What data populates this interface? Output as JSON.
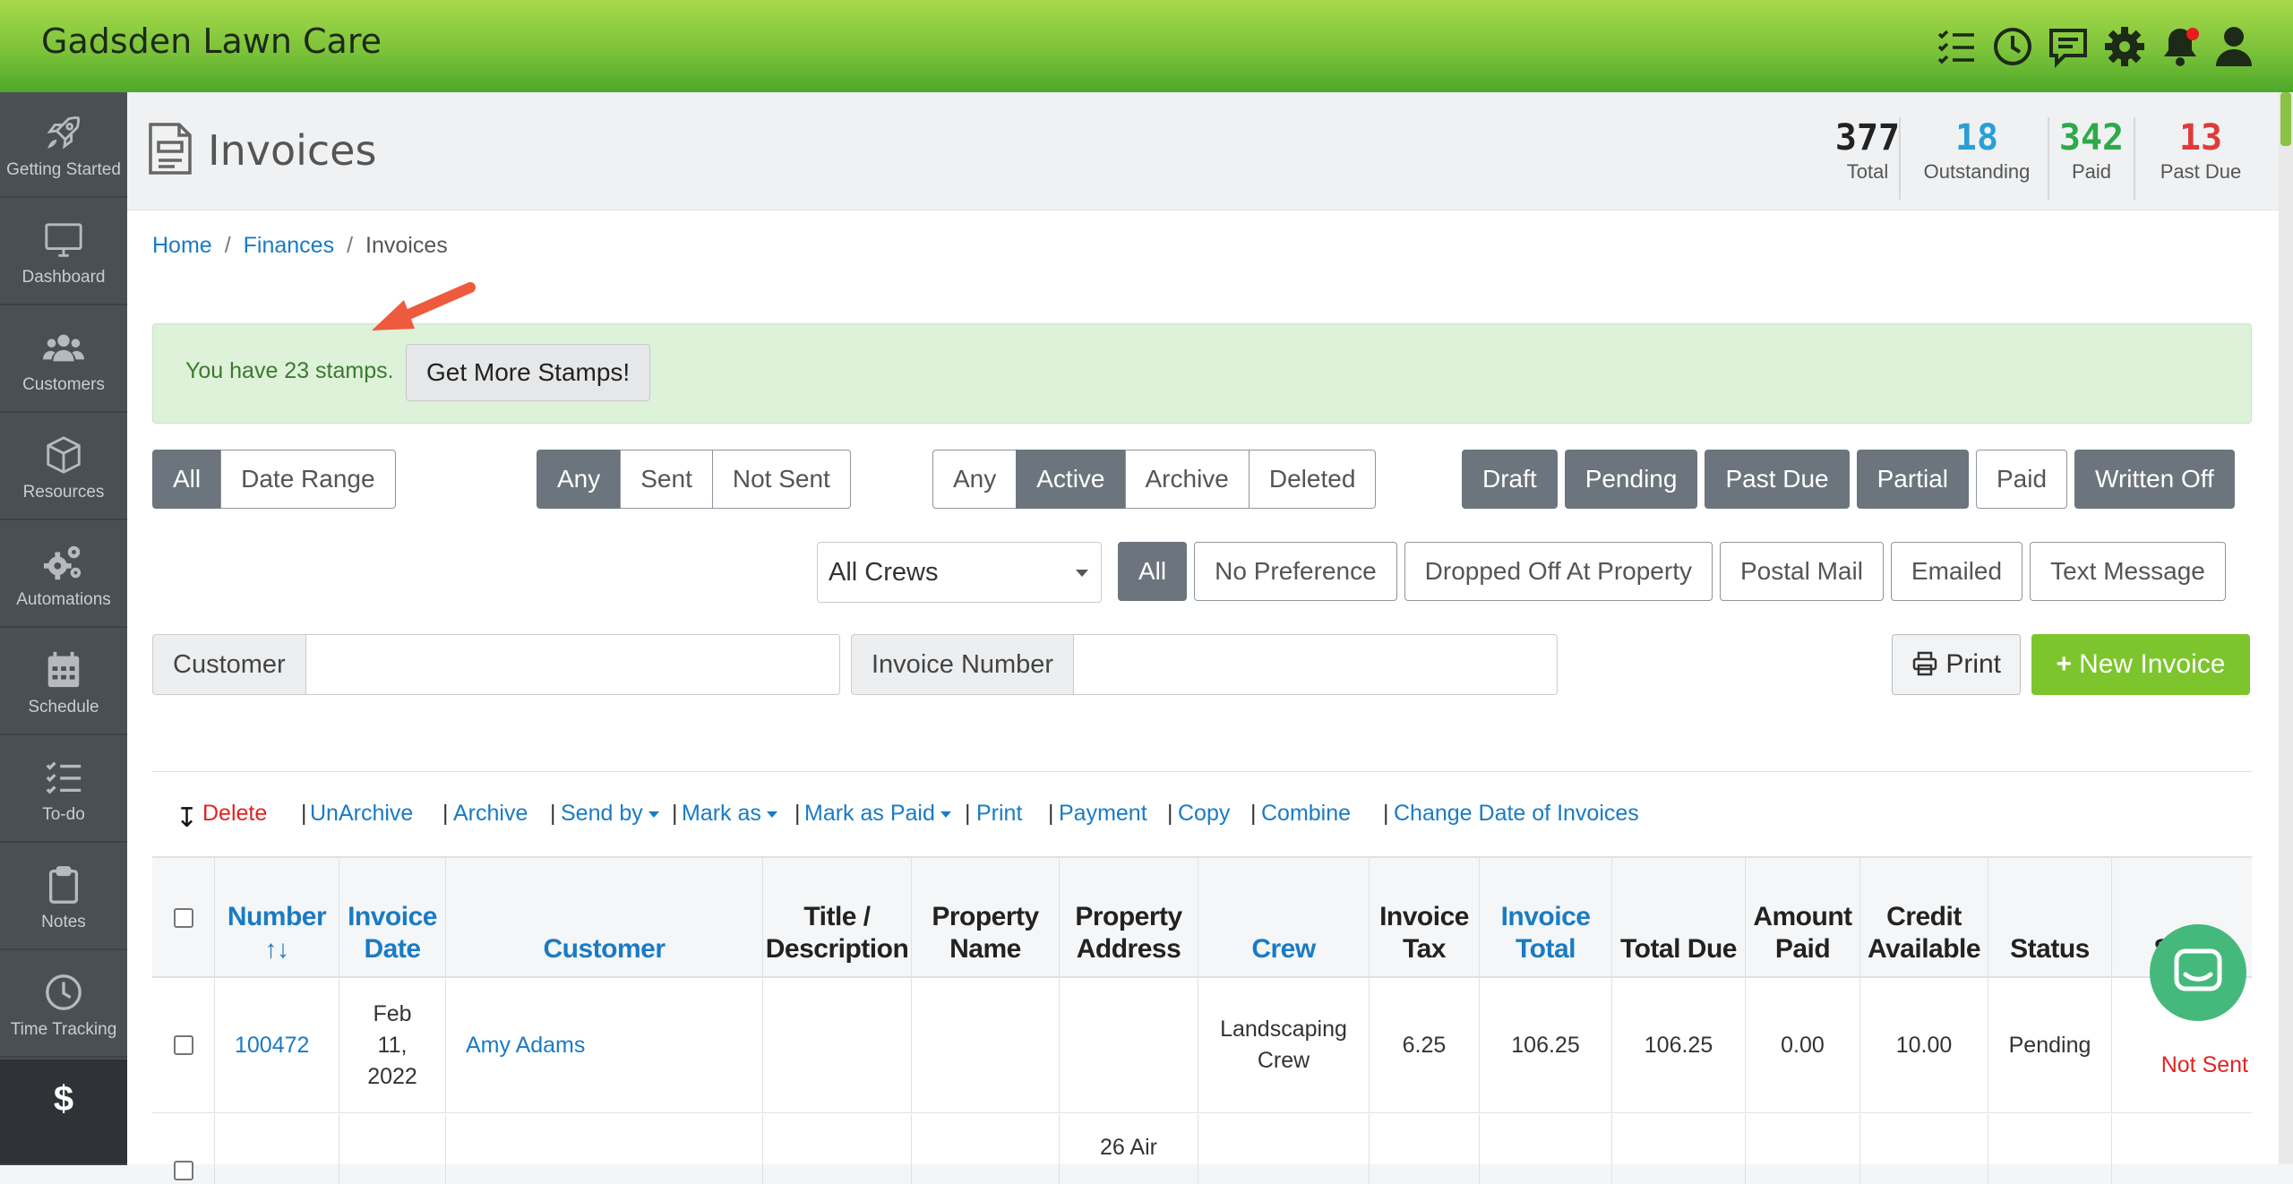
{
  "app": {
    "title": "Gadsden Lawn Care"
  },
  "topbar_icons": [
    "tasks-icon",
    "clock-icon",
    "chat-icon",
    "gear-icon",
    "bell-icon",
    "user-icon"
  ],
  "sidebar": {
    "items": [
      {
        "label": "Getting Started",
        "icon": "rocket-icon"
      },
      {
        "label": "Dashboard",
        "icon": "monitor-icon"
      },
      {
        "label": "Customers",
        "icon": "users-icon"
      },
      {
        "label": "Resources",
        "icon": "box-icon"
      },
      {
        "label": "Automations",
        "icon": "cogs-icon"
      },
      {
        "label": "Schedule",
        "icon": "calendar-icon"
      },
      {
        "label": "To-do",
        "icon": "list-icon"
      },
      {
        "label": "Notes",
        "icon": "clipboard-icon"
      },
      {
        "label": "Time Tracking",
        "icon": "clock-icon"
      },
      {
        "label": "$",
        "icon": "dollar-icon"
      }
    ]
  },
  "page": {
    "title": "Invoices",
    "stats": [
      {
        "value": "377",
        "label": "Total",
        "color": "#222222"
      },
      {
        "value": "18",
        "label": "Outstanding",
        "color": "#2a9fd6"
      },
      {
        "value": "342",
        "label": "Paid",
        "color": "#2eaa4a"
      },
      {
        "value": "13",
        "label": "Past Due",
        "color": "#e03b3b"
      }
    ]
  },
  "breadcrumb": {
    "home": "Home",
    "finances": "Finances",
    "current": "Invoices"
  },
  "stamps": {
    "text": "You have 23 stamps.",
    "button": "Get More Stamps!"
  },
  "filters": {
    "date": [
      "All",
      "Date Range"
    ],
    "sent": [
      "Any",
      "Sent",
      "Not Sent"
    ],
    "state": [
      "Any",
      "Active",
      "Archive",
      "Deleted"
    ],
    "status": [
      "Draft",
      "Pending",
      "Past Due",
      "Partial",
      "Paid",
      "Written Off"
    ],
    "crew_select": "All Crews",
    "delivery": [
      "All",
      "No Preference",
      "Dropped Off At Property",
      "Postal Mail",
      "Emailed",
      "Text Message"
    ]
  },
  "search": {
    "customer_label": "Customer",
    "customer_value": "",
    "invoice_label": "Invoice Number",
    "invoice_value": ""
  },
  "actions": {
    "print": "Print",
    "new_invoice": "New Invoice"
  },
  "bulk": {
    "delete": "Delete",
    "unarchive": "UnArchive",
    "archive": "Archive",
    "send_by": "Send by",
    "mark_as": "Mark as",
    "mark_as_paid": "Mark as Paid",
    "print": "Print",
    "payment": "Payment",
    "copy": "Copy",
    "combine": "Combine",
    "change_date": "Change Date of Invoices"
  },
  "table": {
    "headers": {
      "number": "Number",
      "number_sort": "↑↓",
      "invoice_date": "Invoice Date",
      "customer": "Customer",
      "title": "Title / Description",
      "property_name": "Property Name",
      "property_address": "Property Address",
      "crew": "Crew",
      "invoice_tax": "Invoice Tax",
      "invoice_total": "Invoice Total",
      "total_due": "Total Due",
      "amount_paid": "Amount Paid",
      "credit_available": "Credit Available",
      "status": "Status",
      "sent": "Sent"
    },
    "rows": [
      {
        "number": "100472",
        "invoice_date": "Feb 11, 2022",
        "customer": "Amy Adams",
        "title": "",
        "property_name": "",
        "property_address": "",
        "crew": "Landscaping Crew",
        "invoice_tax": "6.25",
        "invoice_total": "106.25",
        "total_due": "106.25",
        "amount_paid": "0.00",
        "credit_available": "10.00",
        "status": "Pending",
        "sent": "Not Sent"
      },
      {
        "number": "",
        "invoice_date": "",
        "customer": "",
        "title": "",
        "property_name": "",
        "property_address": "26 Air",
        "crew": "",
        "invoice_tax": "",
        "invoice_total": "",
        "total_due": "",
        "amount_paid": "",
        "credit_available": "",
        "status": "",
        "sent": ""
      }
    ]
  }
}
